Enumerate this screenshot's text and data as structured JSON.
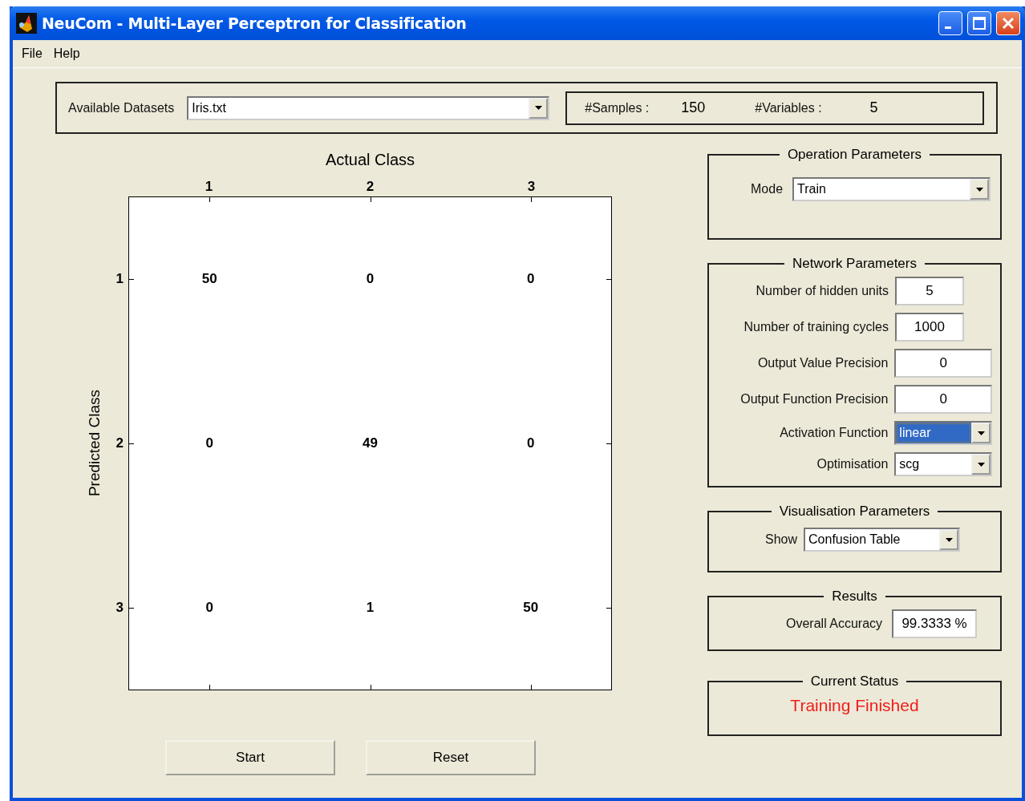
{
  "window": {
    "title": "NeuCom - Multi-Layer Perceptron for Classification"
  },
  "menu": [
    "File",
    "Help"
  ],
  "dataset": {
    "label": "Available Datasets",
    "value": "Iris.txt",
    "focused": false
  },
  "stats": [
    {
      "label": "#Samples :",
      "value": "150"
    },
    {
      "label": "#Variables :",
      "value": "5"
    }
  ],
  "matrix": {
    "title": "Actual Class",
    "ylabel": "Predicted Class",
    "columns": [
      "1",
      "2",
      "3"
    ],
    "rows": [
      {
        "label": "1",
        "cells": [
          "50",
          "0",
          "0"
        ]
      },
      {
        "label": "2",
        "cells": [
          "0",
          "49",
          "0"
        ]
      },
      {
        "label": "3",
        "cells": [
          "0",
          "1",
          "50"
        ]
      }
    ]
  },
  "buttons": [
    "Start",
    "Reset"
  ],
  "panels": [
    {
      "title": "Operation Parameters",
      "fields": [
        {
          "kind": "dropdown",
          "label": "Mode",
          "value": "Train",
          "focused": false
        }
      ]
    },
    {
      "title": "Network Parameters",
      "fields": [
        {
          "kind": "text",
          "label": "Number of hidden units",
          "value": "5"
        },
        {
          "kind": "text",
          "label": "Number of training cycles",
          "value": "1000"
        },
        {
          "kind": "text",
          "label": "Output Value Precision",
          "value": "0"
        },
        {
          "kind": "text",
          "label": "Output Function Precision",
          "value": "0"
        },
        {
          "kind": "dropdown",
          "label": "Activation Function",
          "value": "linear",
          "focused": true
        },
        {
          "kind": "dropdown",
          "label": "Optimisation",
          "value": "scg",
          "focused": false
        }
      ]
    },
    {
      "title": "Visualisation Parameters",
      "fields": [
        {
          "kind": "dropdown",
          "label": "Show",
          "value": "Confusion Table",
          "focused": false
        }
      ]
    },
    {
      "title": "Results",
      "fields": [
        {
          "kind": "text",
          "label": "Overall Accuracy",
          "value": "99.3333 %"
        }
      ]
    },
    {
      "title": "Current Status",
      "fields": [
        {
          "kind": "status",
          "value": "Training Finished"
        }
      ]
    }
  ]
}
